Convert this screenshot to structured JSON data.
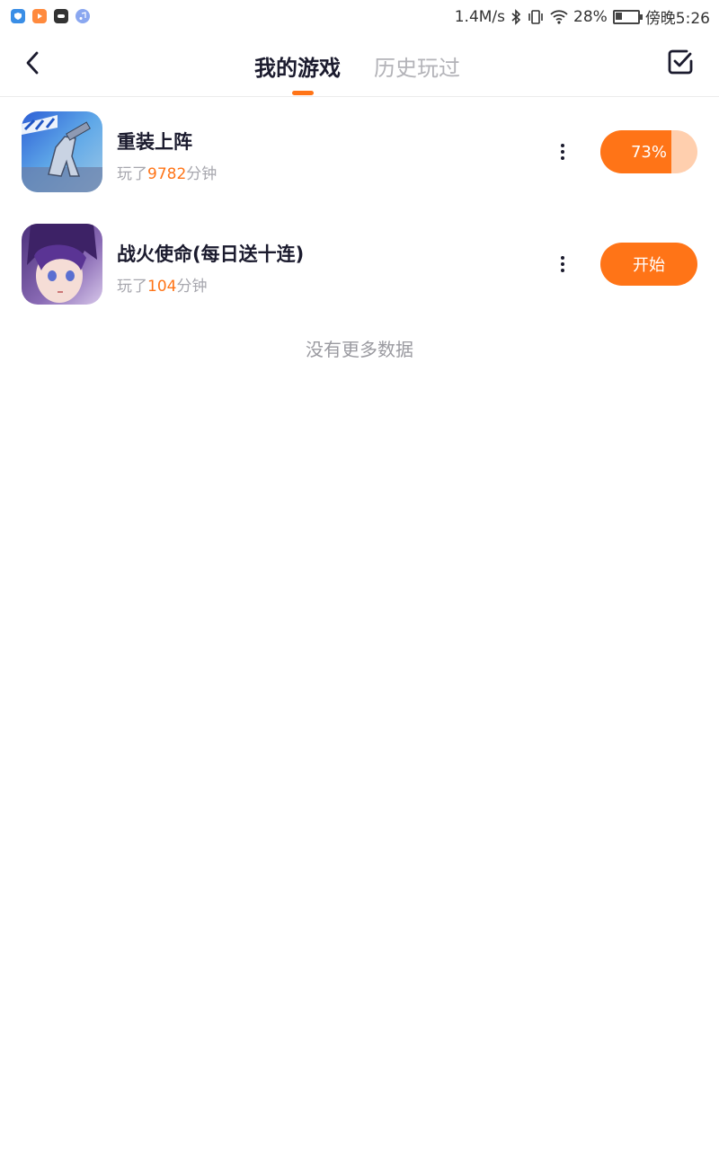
{
  "status_bar": {
    "speed": "1.4M/s",
    "battery_percent": "28%",
    "battery_level": 0.28,
    "time": "傍晚5:26",
    "icons": [
      "shield-app-icon",
      "video-app-icon",
      "game-app-icon",
      "music-app-icon",
      "bluetooth-icon",
      "vibrate-icon",
      "wifi-icon",
      "battery-icon"
    ]
  },
  "header": {
    "tabs": [
      {
        "label": "我的游戏",
        "active": true
      },
      {
        "label": "历史玩过",
        "active": false
      }
    ],
    "back_icon": "chevron-left-icon",
    "select_icon": "checkbox-icon"
  },
  "games": [
    {
      "title": "重装上阵",
      "meta_prefix": "玩了",
      "minutes": "9782",
      "meta_suffix": "分钟",
      "action_type": "progress",
      "progress": 0.73,
      "action_label": "73%"
    },
    {
      "title": "战火使命(每日送十连)",
      "meta_prefix": "玩了",
      "minutes": "104",
      "meta_suffix": "分钟",
      "action_type": "start",
      "action_label": "开始"
    }
  ],
  "footer": {
    "no_more": "没有更多数据"
  },
  "colors": {
    "accent": "#ff7417",
    "accent_light": "#ffcfae",
    "title": "#1b1b2e",
    "muted": "#a7a7ae"
  }
}
